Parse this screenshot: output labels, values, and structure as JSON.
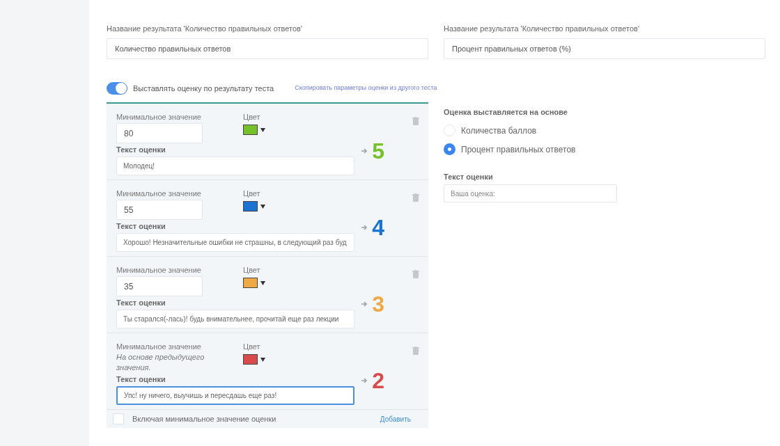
{
  "result_names": [
    {
      "label": "Название результата 'Количество правильных ответов'",
      "value": "Количество правильных ответов"
    },
    {
      "label": "Название результата 'Количество правильных ответов'",
      "value": "Процент правильных ответов (%)"
    }
  ],
  "grading_toggle": {
    "label": "Выставлять оценку по результату теста",
    "on": true
  },
  "copy_link": "Скопировать параметры оценки из другого теста",
  "grades": [
    {
      "min_label": "Минимальное значение",
      "kind": "input",
      "min_value": "80",
      "color_label": "Цвет",
      "color": "#76c02a",
      "text_label": "Текст оценки",
      "text": "Молодец!",
      "focused": false,
      "grade": "5"
    },
    {
      "min_label": "Минимальное значение",
      "kind": "input",
      "min_value": "55",
      "color_label": "Цвет",
      "color": "#1a73d1",
      "text_label": "Текст оценки",
      "text": "Хорошо! Незначительные ошибки не страшны, в следующий раз буд",
      "focused": false,
      "grade": "4"
    },
    {
      "min_label": "Минимальное значение",
      "kind": "input",
      "min_value": "35",
      "color_label": "Цвет",
      "color": "#f0a844",
      "text_label": "Текст оценки",
      "text": "Ты старался(-лась)! будь внимательнее, прочитай еще раз лекции",
      "focused": false,
      "grade": "3"
    },
    {
      "min_label": "Минимальное значение",
      "kind": "derived",
      "min_value": "На основе предыдущего значения.",
      "color_label": "Цвет",
      "color": "#d94b4b",
      "text_label": "Текст оценки",
      "text": "Упс! ну ничего, выучишь и пересдашь еще раз! ",
      "focused": true,
      "grade": "2"
    }
  ],
  "include_min": {
    "label": "Включая минимальное значение оценки",
    "checked": false
  },
  "add_link": "Добавить",
  "basis": {
    "heading": "Оценка выставляется на основе",
    "options": [
      {
        "label": "Количества баллов",
        "selected": false
      },
      {
        "label": "Процент правильных ответов",
        "selected": true
      }
    ]
  },
  "grade_text": {
    "label": "Текст оценки",
    "placeholder": "Ваша оценка:"
  }
}
